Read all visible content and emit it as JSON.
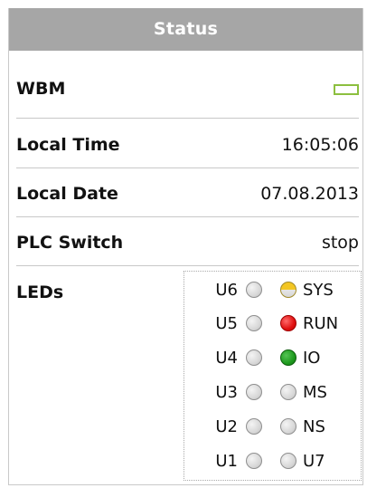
{
  "panel": {
    "title": "Status"
  },
  "rows": {
    "wbm": {
      "label": "WBM",
      "indicator_color": "#8cbf3f"
    },
    "local_time": {
      "label": "Local Time",
      "value": "16:05:06"
    },
    "local_date": {
      "label": "Local Date",
      "value": "07.08.2013"
    },
    "plc_switch": {
      "label": "PLC Switch",
      "value": "stop"
    },
    "leds": {
      "label": "LEDs"
    }
  },
  "led_rows": [
    {
      "left": "U6",
      "right": "SYS",
      "right_state": "yellow-half"
    },
    {
      "left": "U5",
      "right": "RUN",
      "right_state": "red"
    },
    {
      "left": "U4",
      "right": "IO",
      "right_state": "green"
    },
    {
      "left": "U3",
      "right": "MS",
      "right_state": "off"
    },
    {
      "left": "U2",
      "right": "NS",
      "right_state": "off"
    },
    {
      "left": "U1",
      "right": "U7",
      "right_state": "off"
    }
  ],
  "colors": {
    "header_bg": "#a6a6a6",
    "led_red": "#e01010",
    "led_green": "#1e9a1e",
    "led_yellow": "#f3c623"
  }
}
